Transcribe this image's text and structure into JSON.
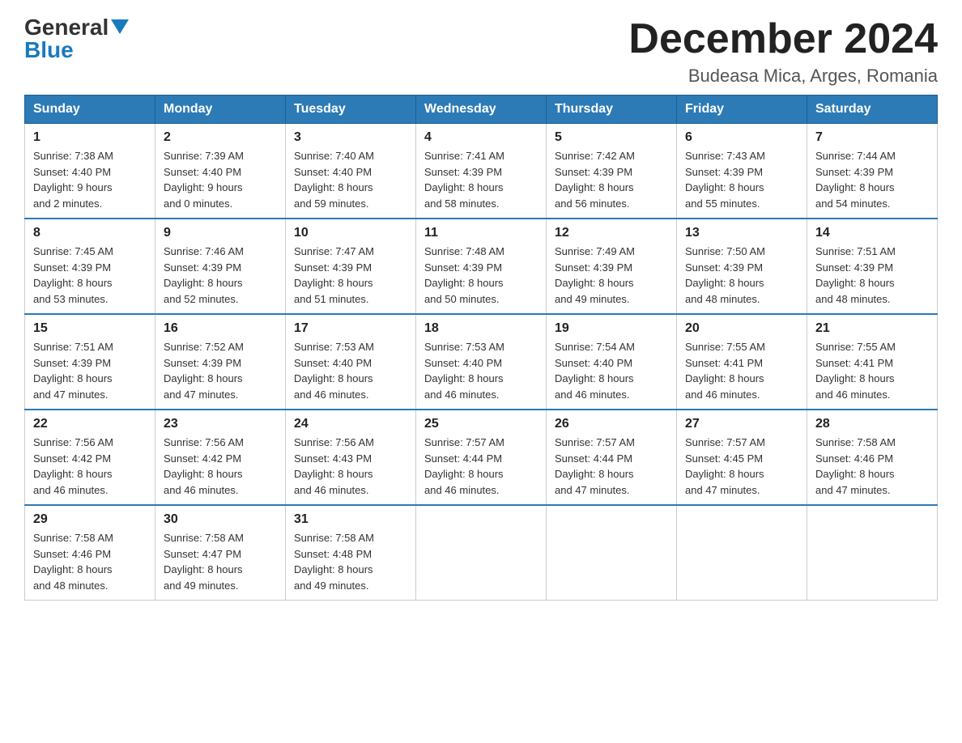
{
  "header": {
    "logo": {
      "general": "General",
      "blue": "Blue",
      "triangle": "▶"
    },
    "month_title": "December 2024",
    "location": "Budeasa Mica, Arges, Romania"
  },
  "weekdays": [
    "Sunday",
    "Monday",
    "Tuesday",
    "Wednesday",
    "Thursday",
    "Friday",
    "Saturday"
  ],
  "weeks": [
    [
      {
        "day": "1",
        "sunrise": "7:38 AM",
        "sunset": "4:40 PM",
        "daylight": "9 hours and 2 minutes."
      },
      {
        "day": "2",
        "sunrise": "7:39 AM",
        "sunset": "4:40 PM",
        "daylight": "9 hours and 0 minutes."
      },
      {
        "day": "3",
        "sunrise": "7:40 AM",
        "sunset": "4:40 PM",
        "daylight": "8 hours and 59 minutes."
      },
      {
        "day": "4",
        "sunrise": "7:41 AM",
        "sunset": "4:39 PM",
        "daylight": "8 hours and 58 minutes."
      },
      {
        "day": "5",
        "sunrise": "7:42 AM",
        "sunset": "4:39 PM",
        "daylight": "8 hours and 56 minutes."
      },
      {
        "day": "6",
        "sunrise": "7:43 AM",
        "sunset": "4:39 PM",
        "daylight": "8 hours and 55 minutes."
      },
      {
        "day": "7",
        "sunrise": "7:44 AM",
        "sunset": "4:39 PM",
        "daylight": "8 hours and 54 minutes."
      }
    ],
    [
      {
        "day": "8",
        "sunrise": "7:45 AM",
        "sunset": "4:39 PM",
        "daylight": "8 hours and 53 minutes."
      },
      {
        "day": "9",
        "sunrise": "7:46 AM",
        "sunset": "4:39 PM",
        "daylight": "8 hours and 52 minutes."
      },
      {
        "day": "10",
        "sunrise": "7:47 AM",
        "sunset": "4:39 PM",
        "daylight": "8 hours and 51 minutes."
      },
      {
        "day": "11",
        "sunrise": "7:48 AM",
        "sunset": "4:39 PM",
        "daylight": "8 hours and 50 minutes."
      },
      {
        "day": "12",
        "sunrise": "7:49 AM",
        "sunset": "4:39 PM",
        "daylight": "8 hours and 49 minutes."
      },
      {
        "day": "13",
        "sunrise": "7:50 AM",
        "sunset": "4:39 PM",
        "daylight": "8 hours and 48 minutes."
      },
      {
        "day": "14",
        "sunrise": "7:51 AM",
        "sunset": "4:39 PM",
        "daylight": "8 hours and 48 minutes."
      }
    ],
    [
      {
        "day": "15",
        "sunrise": "7:51 AM",
        "sunset": "4:39 PM",
        "daylight": "8 hours and 47 minutes."
      },
      {
        "day": "16",
        "sunrise": "7:52 AM",
        "sunset": "4:39 PM",
        "daylight": "8 hours and 47 minutes."
      },
      {
        "day": "17",
        "sunrise": "7:53 AM",
        "sunset": "4:40 PM",
        "daylight": "8 hours and 46 minutes."
      },
      {
        "day": "18",
        "sunrise": "7:53 AM",
        "sunset": "4:40 PM",
        "daylight": "8 hours and 46 minutes."
      },
      {
        "day": "19",
        "sunrise": "7:54 AM",
        "sunset": "4:40 PM",
        "daylight": "8 hours and 46 minutes."
      },
      {
        "day": "20",
        "sunrise": "7:55 AM",
        "sunset": "4:41 PM",
        "daylight": "8 hours and 46 minutes."
      },
      {
        "day": "21",
        "sunrise": "7:55 AM",
        "sunset": "4:41 PM",
        "daylight": "8 hours and 46 minutes."
      }
    ],
    [
      {
        "day": "22",
        "sunrise": "7:56 AM",
        "sunset": "4:42 PM",
        "daylight": "8 hours and 46 minutes."
      },
      {
        "day": "23",
        "sunrise": "7:56 AM",
        "sunset": "4:42 PM",
        "daylight": "8 hours and 46 minutes."
      },
      {
        "day": "24",
        "sunrise": "7:56 AM",
        "sunset": "4:43 PM",
        "daylight": "8 hours and 46 minutes."
      },
      {
        "day": "25",
        "sunrise": "7:57 AM",
        "sunset": "4:44 PM",
        "daylight": "8 hours and 46 minutes."
      },
      {
        "day": "26",
        "sunrise": "7:57 AM",
        "sunset": "4:44 PM",
        "daylight": "8 hours and 47 minutes."
      },
      {
        "day": "27",
        "sunrise": "7:57 AM",
        "sunset": "4:45 PM",
        "daylight": "8 hours and 47 minutes."
      },
      {
        "day": "28",
        "sunrise": "7:58 AM",
        "sunset": "4:46 PM",
        "daylight": "8 hours and 47 minutes."
      }
    ],
    [
      {
        "day": "29",
        "sunrise": "7:58 AM",
        "sunset": "4:46 PM",
        "daylight": "8 hours and 48 minutes."
      },
      {
        "day": "30",
        "sunrise": "7:58 AM",
        "sunset": "4:47 PM",
        "daylight": "8 hours and 49 minutes."
      },
      {
        "day": "31",
        "sunrise": "7:58 AM",
        "sunset": "4:48 PM",
        "daylight": "8 hours and 49 minutes."
      },
      null,
      null,
      null,
      null
    ]
  ]
}
